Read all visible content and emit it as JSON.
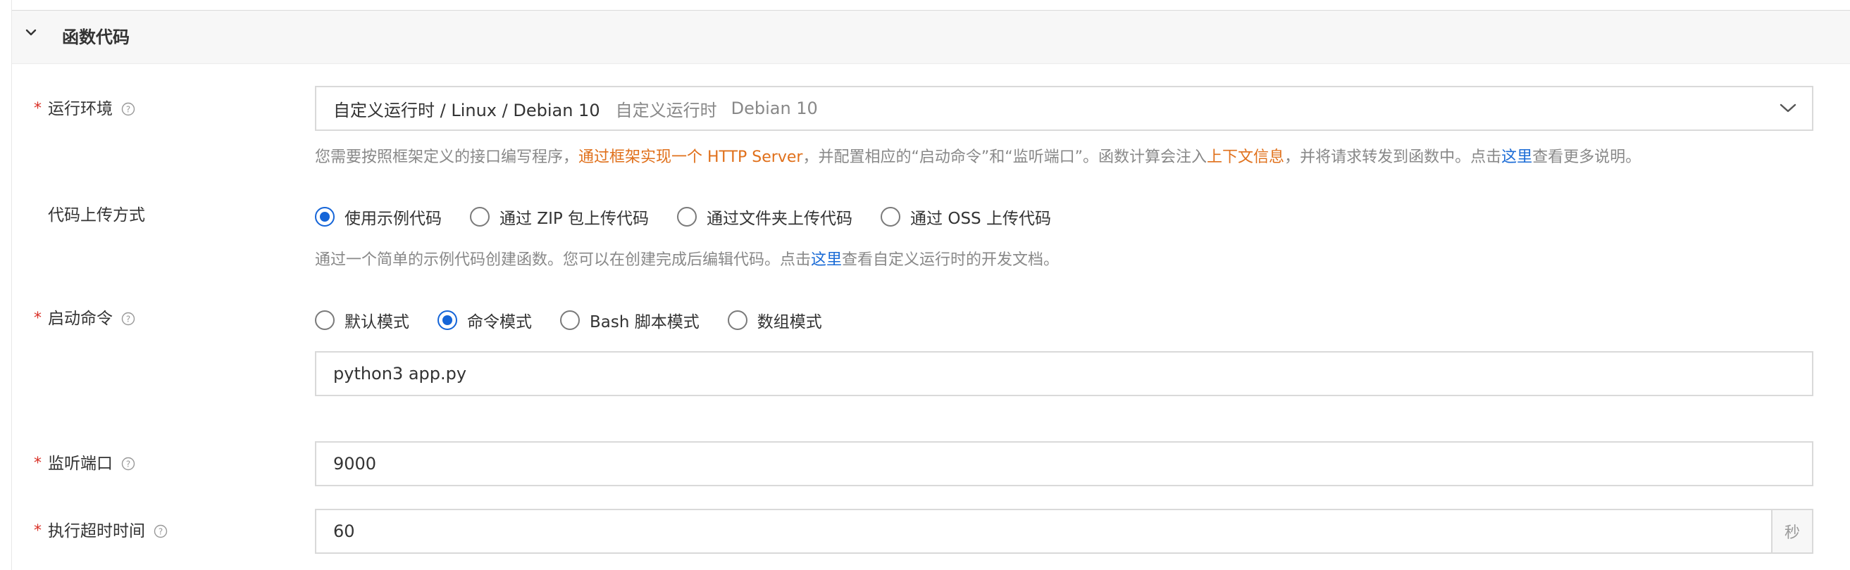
{
  "section": {
    "title": "函数代码"
  },
  "runtime": {
    "label": "运行环境",
    "selected_main": "自定义运行时 / Linux / Debian 10",
    "selected_tag1": "自定义运行时",
    "selected_tag2": "Debian 10",
    "hint_pre": "您需要按照框架定义的接口编写程序，",
    "hint_link1": "通过框架实现一个 HTTP Server",
    "hint_mid": "，并配置相应的“启动命令”和“监听端口”。函数计算会注入",
    "hint_link2": "上下文信息",
    "hint_mid2": "，并将请求转发到函数中。点击",
    "hint_link3": "这里",
    "hint_post": "查看更多说明。"
  },
  "upload": {
    "label": "代码上传方式",
    "options": [
      "使用示例代码",
      "通过 ZIP 包上传代码",
      "通过文件夹上传代码",
      "通过 OSS 上传代码"
    ],
    "selected": "使用示例代码",
    "hint_pre": "通过一个简单的示例代码创建函数。您可以在创建完成后编辑代码。点击",
    "hint_link": "这里",
    "hint_post": "查看自定义运行时的开发文档。"
  },
  "startup": {
    "label": "启动命令",
    "options": [
      "默认模式",
      "命令模式",
      "Bash 脚本模式",
      "数组模式"
    ],
    "selected": "命令模式",
    "command": "python3 app.py"
  },
  "port": {
    "label": "监听端口",
    "value": "9000"
  },
  "timeout": {
    "label": "执行超时时间",
    "value": "60",
    "unit": "秒"
  },
  "colors": {
    "required": "#d93026",
    "accent": "#1565d8",
    "link_orange": "#e0701b",
    "link_blue": "#1a6bd6"
  },
  "icons": {
    "collapse": "chevron-down-icon",
    "help": "question-circle-icon",
    "select": "chevron-down-icon"
  }
}
